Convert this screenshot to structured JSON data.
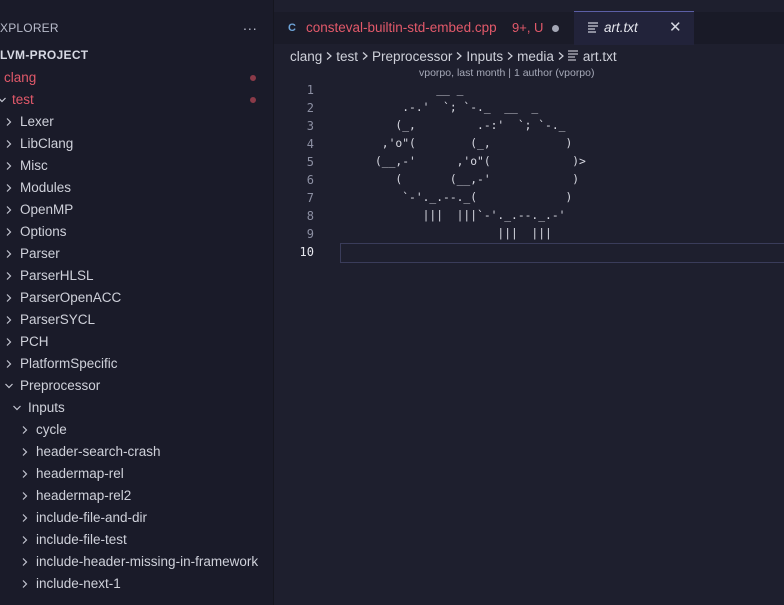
{
  "sidebar": {
    "title": "XPLORER",
    "more_icon": "...",
    "project": "LVM-PROJECT",
    "items": [
      {
        "label": "clang",
        "chevron": "",
        "modified": true
      },
      {
        "label": "test",
        "chevron": "down",
        "modified": true
      },
      {
        "label": "Lexer",
        "chevron": "right"
      },
      {
        "label": "LibClang",
        "chevron": "right"
      },
      {
        "label": "Misc",
        "chevron": "right"
      },
      {
        "label": "Modules",
        "chevron": "right"
      },
      {
        "label": "OpenMP",
        "chevron": "right"
      },
      {
        "label": "Options",
        "chevron": "right"
      },
      {
        "label": "Parser",
        "chevron": "right"
      },
      {
        "label": "ParserHLSL",
        "chevron": "right"
      },
      {
        "label": "ParserOpenACC",
        "chevron": "right"
      },
      {
        "label": "ParserSYCL",
        "chevron": "right"
      },
      {
        "label": "PCH",
        "chevron": "right"
      },
      {
        "label": "PlatformSpecific",
        "chevron": "right"
      },
      {
        "label": "Preprocessor",
        "chevron": "down"
      },
      {
        "label": "Inputs",
        "chevron": "down"
      },
      {
        "label": "cycle",
        "chevron": "right"
      },
      {
        "label": "header-search-crash",
        "chevron": "right"
      },
      {
        "label": "headermap-rel",
        "chevron": "right"
      },
      {
        "label": "headermap-rel2",
        "chevron": "right"
      },
      {
        "label": "include-file-and-dir",
        "chevron": "right"
      },
      {
        "label": "include-file-test",
        "chevron": "right"
      },
      {
        "label": "include-header-missing-in-framework",
        "chevron": "right"
      },
      {
        "label": "include-next-1",
        "chevron": "right"
      }
    ]
  },
  "tabs": [
    {
      "icon": "cpp-file-icon",
      "icon_text": "C",
      "label": "consteval-builtin-std-embed.cpp",
      "status": "9+, U",
      "dirty": true
    },
    {
      "icon": "text-file-icon",
      "label": "art.txt",
      "close": "✕",
      "active": true
    }
  ],
  "breadcrumb": [
    "clang",
    "test",
    "Preprocessor",
    "Inputs",
    "media",
    "art.txt"
  ],
  "blame": "vporpo, last month | 1 author (vporpo)",
  "editor": {
    "line_numbers": [
      "1",
      "2",
      "3",
      "4",
      "5",
      "6",
      "7",
      "8",
      "9",
      "10"
    ],
    "active_line": "10",
    "lines": [
      "              __ _",
      "         .-.'  `; `-._  __  _",
      "        (_,         .-:'  `; `-._",
      "      ,'o\"(        (_,           )",
      "     (__,-'      ,'o\"(            )>",
      "        (       (__,-'            )",
      "         `-'._.--._(             )",
      "            |||  |||`-'._.--._.-'",
      "                       |||  |||",
      ""
    ]
  },
  "colors": {
    "modified": "#e2596a",
    "background": "#1e1f2e",
    "sidebar": "#1a1b29"
  }
}
